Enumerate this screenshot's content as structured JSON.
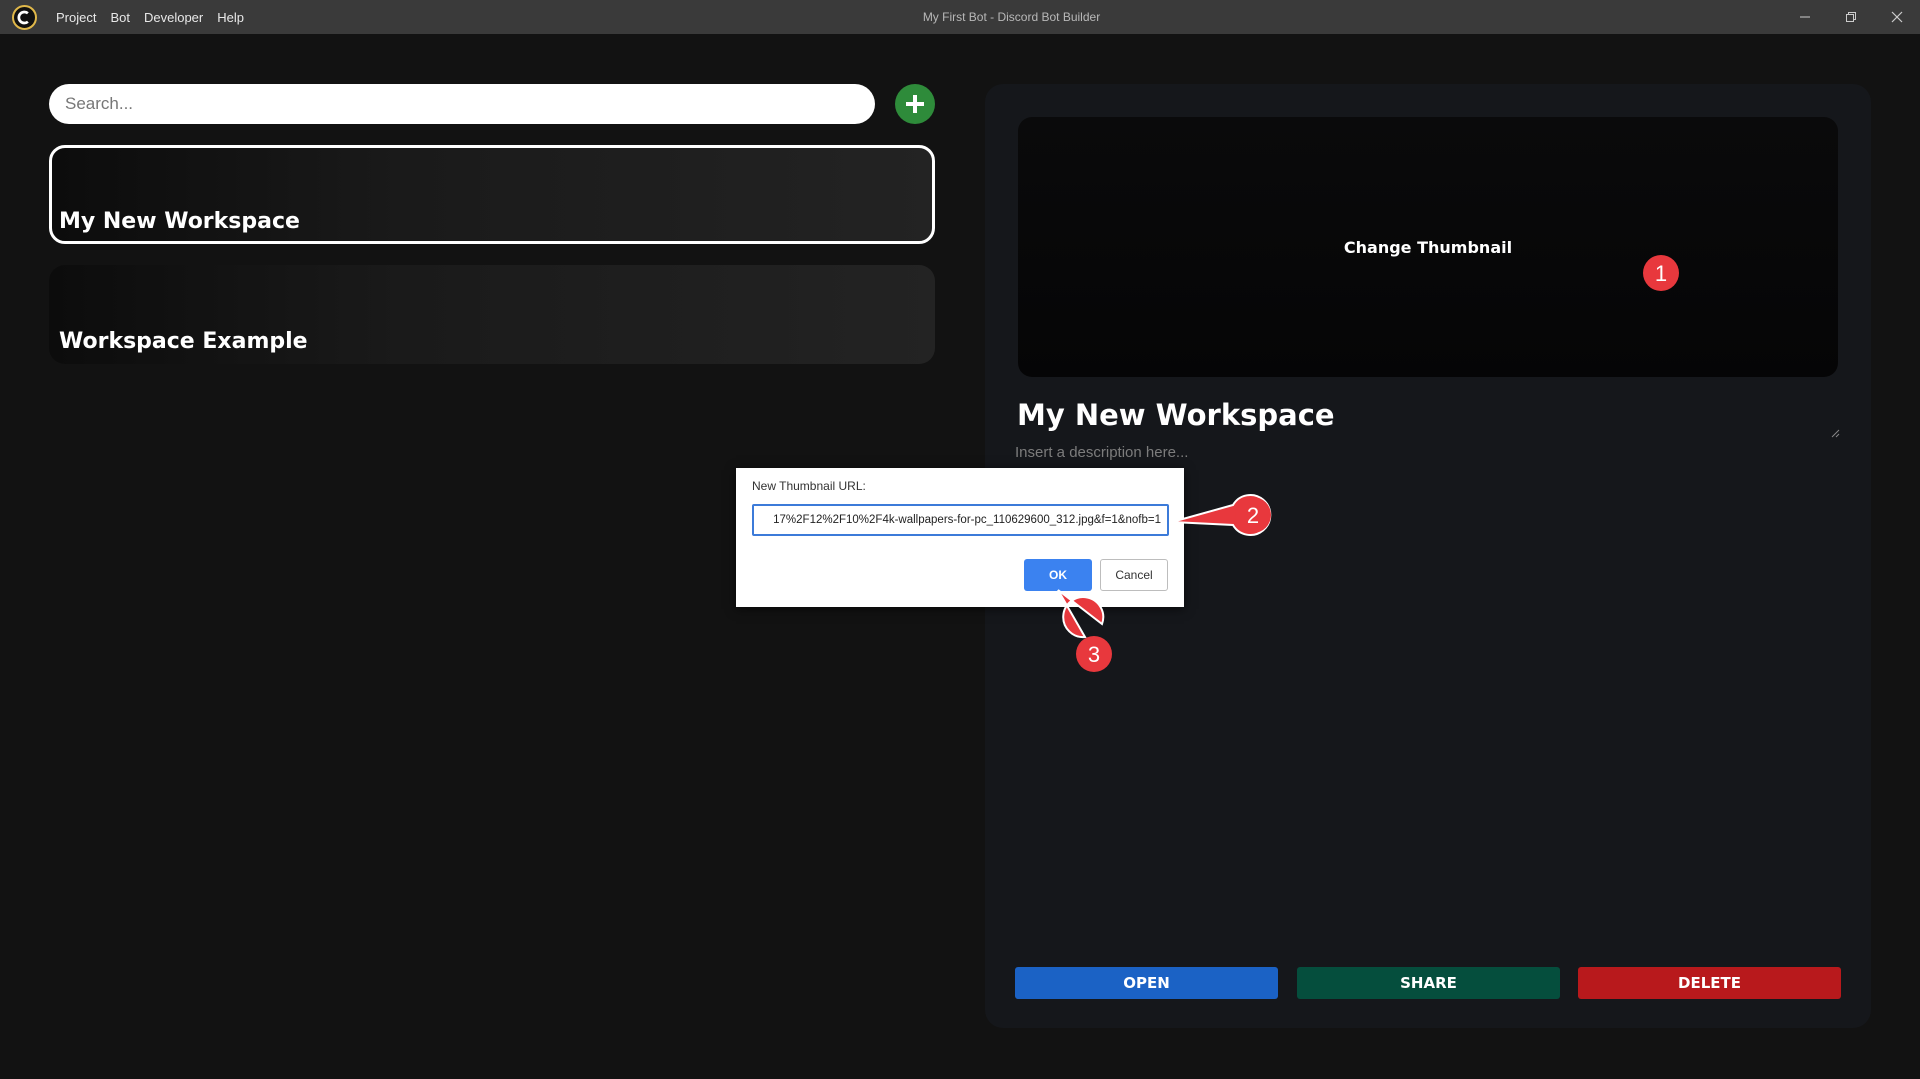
{
  "window": {
    "title": "My First Bot - Discord Bot Builder",
    "menu": [
      "Project",
      "Bot",
      "Developer",
      "Help"
    ]
  },
  "sidebar": {
    "search_placeholder": "Search...",
    "workspaces": [
      {
        "title": "My New Workspace",
        "selected": true
      },
      {
        "title": "Workspace Example",
        "selected": false
      }
    ]
  },
  "details": {
    "thumbnail_label": "Change Thumbnail",
    "title": "My New Workspace",
    "description_placeholder": "Insert a description here...",
    "buttons": {
      "open": "OPEN",
      "share": "SHARE",
      "delete": "DELETE"
    }
  },
  "dialog": {
    "label": "New Thumbnail URL:",
    "value": "17%2F12%2F10%2F4k-wallpapers-for-pc_110629600_312.jpg&f=1&nofb=1",
    "ok": "OK",
    "cancel": "Cancel"
  },
  "annotations": [
    "1",
    "2",
    "3"
  ],
  "colors": {
    "add_button": "#2e8b3a",
    "open": "#1b62c5",
    "share": "#054e3d",
    "delete": "#b8191c",
    "dialog_ok": "#3b82f0",
    "marker": "#e8383d"
  }
}
